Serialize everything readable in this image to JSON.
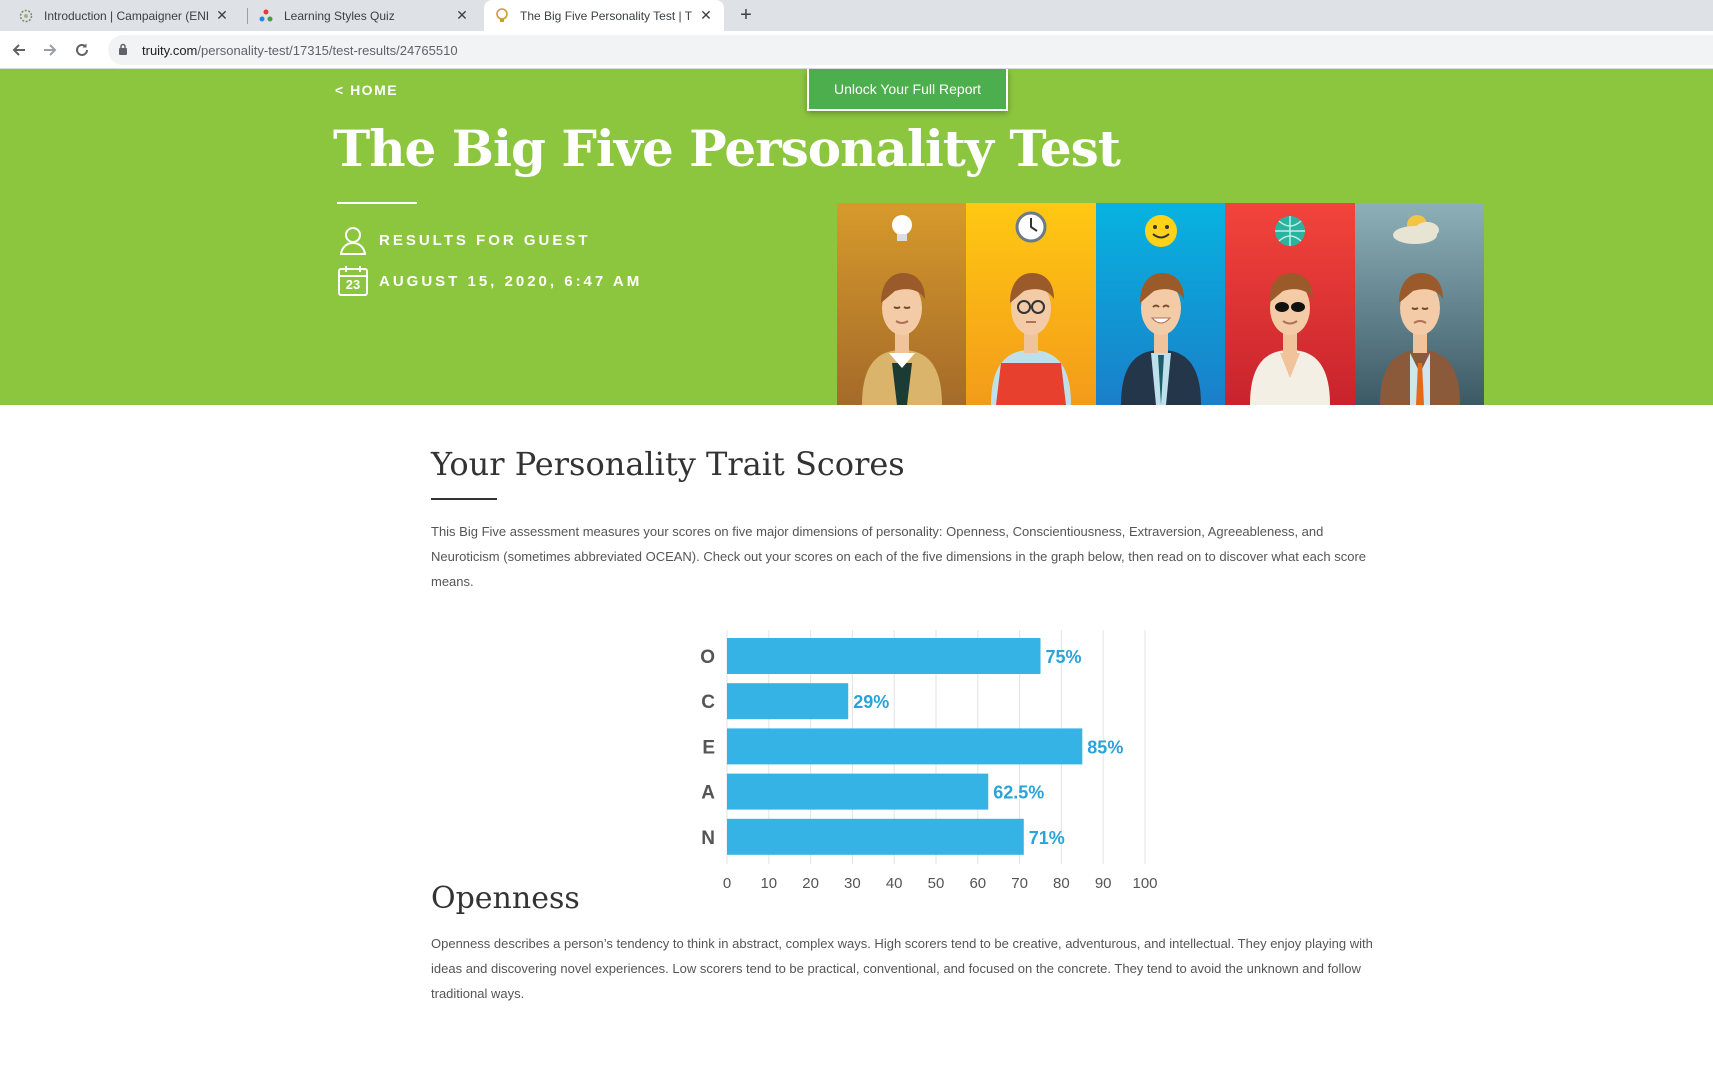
{
  "browser": {
    "tabs": [
      {
        "title": "Introduction | Campaigner (ENFP",
        "active": false
      },
      {
        "title": "Learning Styles Quiz",
        "active": false
      },
      {
        "title": "The Big Five Personality Test | Tru",
        "active": true
      }
    ],
    "url_host": "truity.com",
    "url_path": "/personality-test/17315/test-results/24765510"
  },
  "hero": {
    "home_link": "< HOME",
    "unlock_button": "Unlock Your Full Report",
    "title": "The Big Five Personality Test",
    "results_for": "RESULTS FOR GUEST",
    "date": "AUGUST 15, 2020, 6:47 AM",
    "calendar_day": "23",
    "colors": {
      "hero_bg": "#8cc63f",
      "button_bg": "#4cae4c"
    }
  },
  "scores_section": {
    "heading": "Your Personality Trait Scores",
    "intro": "This Big Five assessment measures your scores on five major dimensions of personality: Openness, Conscientiousness, Extraversion, Agreeableness, and Neuroticism (sometimes abbreviated OCEAN). Check out your scores on each of the five dimensions in the graph below, then read on to discover what each score means."
  },
  "openness_section": {
    "heading": "Openness",
    "body": "Openness describes a person’s tendency to think in abstract, complex ways. High scorers tend to be creative, adventurous, and intellectual. They enjoy playing with ideas and discovering novel experiences. Low scorers tend to be practical, conventional, and focused on the concrete. They tend to avoid the unknown and follow traditional ways."
  },
  "chart_data": {
    "type": "bar",
    "orientation": "horizontal",
    "categories": [
      "O",
      "C",
      "E",
      "A",
      "N"
    ],
    "values": [
      75,
      29,
      85,
      62.5,
      71
    ],
    "value_labels": [
      "75%",
      "29%",
      "85%",
      "62.5%",
      "71%"
    ],
    "xlim": [
      0,
      100
    ],
    "xticks": [
      "0",
      "10",
      "20",
      "30",
      "40",
      "50",
      "60",
      "70",
      "80",
      "90",
      "100"
    ],
    "grid": true,
    "bar_color": "#35b3e5",
    "label_color": "#2aa3d9"
  }
}
